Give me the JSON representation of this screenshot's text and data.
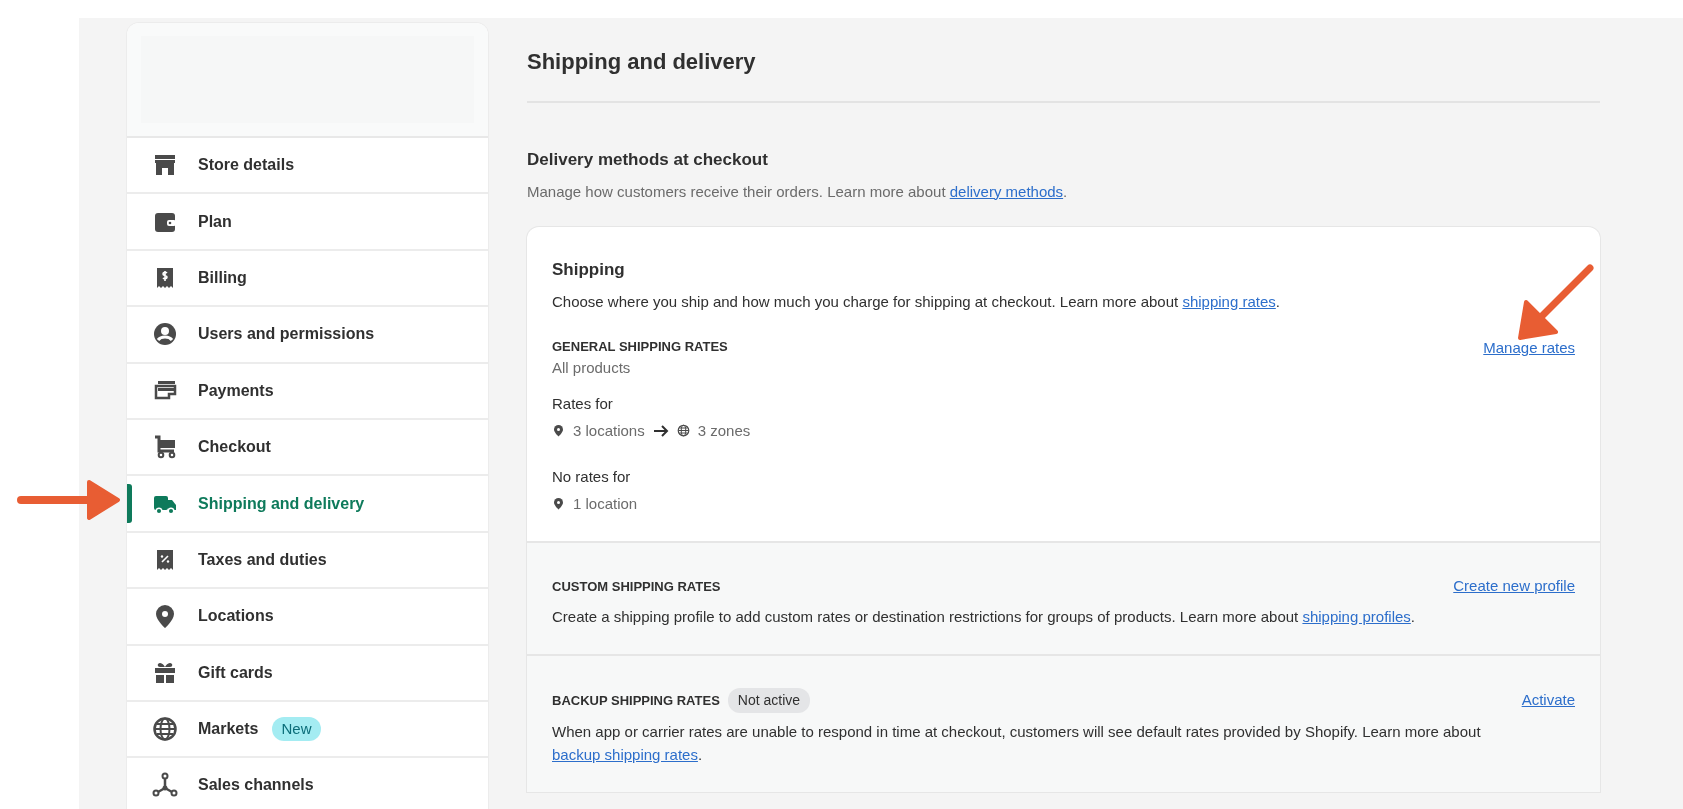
{
  "sidebar": {
    "items": [
      {
        "label": "Store details",
        "selected": false
      },
      {
        "label": "Plan",
        "selected": false
      },
      {
        "label": "Billing",
        "selected": false
      },
      {
        "label": "Users and permissions",
        "selected": false
      },
      {
        "label": "Payments",
        "selected": false
      },
      {
        "label": "Checkout",
        "selected": false
      },
      {
        "label": "Shipping and delivery",
        "selected": true
      },
      {
        "label": "Taxes and duties",
        "selected": false
      },
      {
        "label": "Locations",
        "selected": false
      },
      {
        "label": "Gift cards",
        "selected": false
      },
      {
        "label": "Markets",
        "selected": false,
        "badge": "New"
      },
      {
        "label": "Sales channels",
        "selected": false
      }
    ]
  },
  "page": {
    "title": "Shipping and delivery",
    "section": {
      "heading": "Delivery methods at checkout",
      "description": {
        "text": "Manage how customers receive their orders. Learn more about ",
        "link": "delivery methods",
        "after": "."
      }
    },
    "shipping_card": {
      "heading": "Shipping",
      "description": {
        "text": "Choose where you ship and how much you charge for shipping at checkout. Learn more about ",
        "link": "shipping rates",
        "after": "."
      },
      "general": {
        "label": "GENERAL SHIPPING RATES",
        "subtitle": "All products",
        "action": "Manage rates",
        "rates_for": {
          "label": "Rates for",
          "locations": "3 locations",
          "zones": "3 zones"
        },
        "no_rates_for": {
          "label": "No rates for",
          "locations": "1 location"
        }
      },
      "custom": {
        "label": "CUSTOM SHIPPING RATES",
        "action": "Create new profile",
        "description": {
          "text": "Create a shipping profile to add custom rates or destination restrictions for groups of products. Learn more about ",
          "link": "shipping profiles",
          "after": "."
        }
      },
      "backup": {
        "label": "BACKUP SHIPPING RATES",
        "status": "Not active",
        "action": "Activate",
        "description": {
          "text": "When app or carrier rates are unable to respond in time at checkout, customers will see default rates provided by Shopify. Learn more about ",
          "link": "backup shipping rates",
          "after": "."
        }
      }
    }
  }
}
